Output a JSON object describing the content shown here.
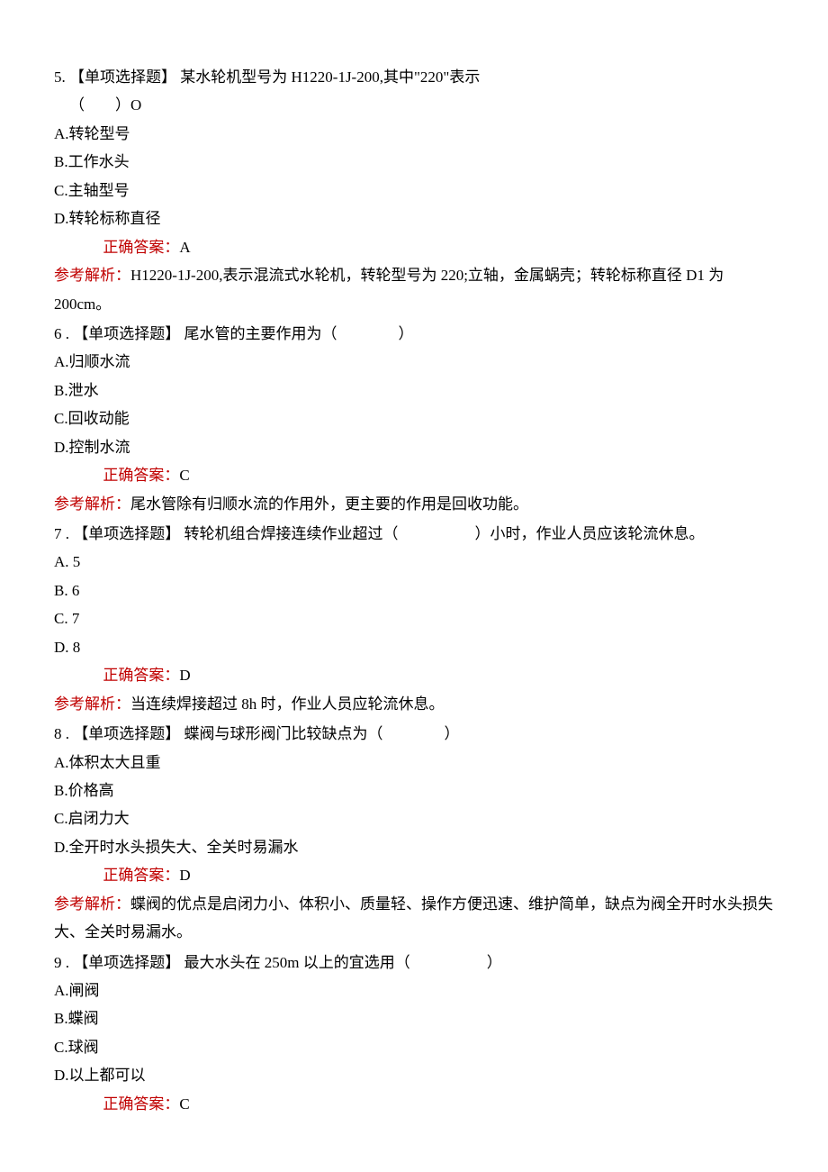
{
  "questions": [
    {
      "num": "5.",
      "tag": "【单项选择题】",
      "stem_a": "某水轮机型号为 H1220-1J-200,其中\"220\"表示",
      "stem_b": "（　　）O",
      "options": [
        "A.转轮型号",
        "B.工作水头",
        "C.主轴型号",
        "D.转轮标称直径"
      ],
      "answer_label": "正确答案：",
      "answer": "A",
      "explain_label": "参考解析：",
      "explain": "H1220-1J-200,表示混流式水轮机，转轮型号为 220;立轴，金属蜗壳；转轮标称直径 D1 为 200cm。"
    },
    {
      "num": "6 .",
      "tag": "【单项选择题】",
      "stem_a": "尾水管的主要作用为（　　　　）",
      "stem_b": "",
      "options": [
        "A.归顺水流",
        "B.泄水",
        "C.回收动能",
        "D.控制水流"
      ],
      "answer_label": "正确答案：",
      "answer": "C",
      "explain_label": "参考解析：",
      "explain": "尾水管除有归顺水流的作用外，更主要的作用是回收功能。"
    },
    {
      "num": "7 .",
      "tag": "【单项选择题】",
      "stem_a": "转轮机组合焊接连续作业超过（　　　　　）小时，作业人员应该轮流休息。",
      "stem_b": "",
      "options": [
        "A.  5",
        "B.  6",
        "C.  7",
        "D.  8"
      ],
      "answer_label": "正确答案：",
      "answer": "D",
      "explain_label": "参考解析：",
      "explain": "当连续焊接超过 8h 时，作业人员应轮流休息。"
    },
    {
      "num": "8 .",
      "tag": "【单项选择题】",
      "stem_a": "蝶阀与球形阀门比较缺点为（　　　　）",
      "stem_b": "",
      "options": [
        "A.体积太大且重",
        "B.价格高",
        "C.启闭力大",
        "D.全开时水头损失大、全关时易漏水"
      ],
      "answer_label": "正确答案：",
      "answer": "D",
      "explain_label": "参考解析：",
      "explain": "蝶阀的优点是启闭力小、体积小、质量轻、操作方便迅速、维护简单，缺点为阀全开时水头损失大、全关时易漏水。"
    },
    {
      "num": "9 .",
      "tag": "【单项选择题】",
      "stem_a": "最大水头在 250m 以上的宜选用（　　　　　）",
      "stem_b": "",
      "options": [
        "A.闸阀",
        "B.蝶阀",
        "C.球阀",
        "D.以上都可以"
      ],
      "answer_label": "正确答案：",
      "answer": "C",
      "explain_label": "",
      "explain": ""
    }
  ]
}
